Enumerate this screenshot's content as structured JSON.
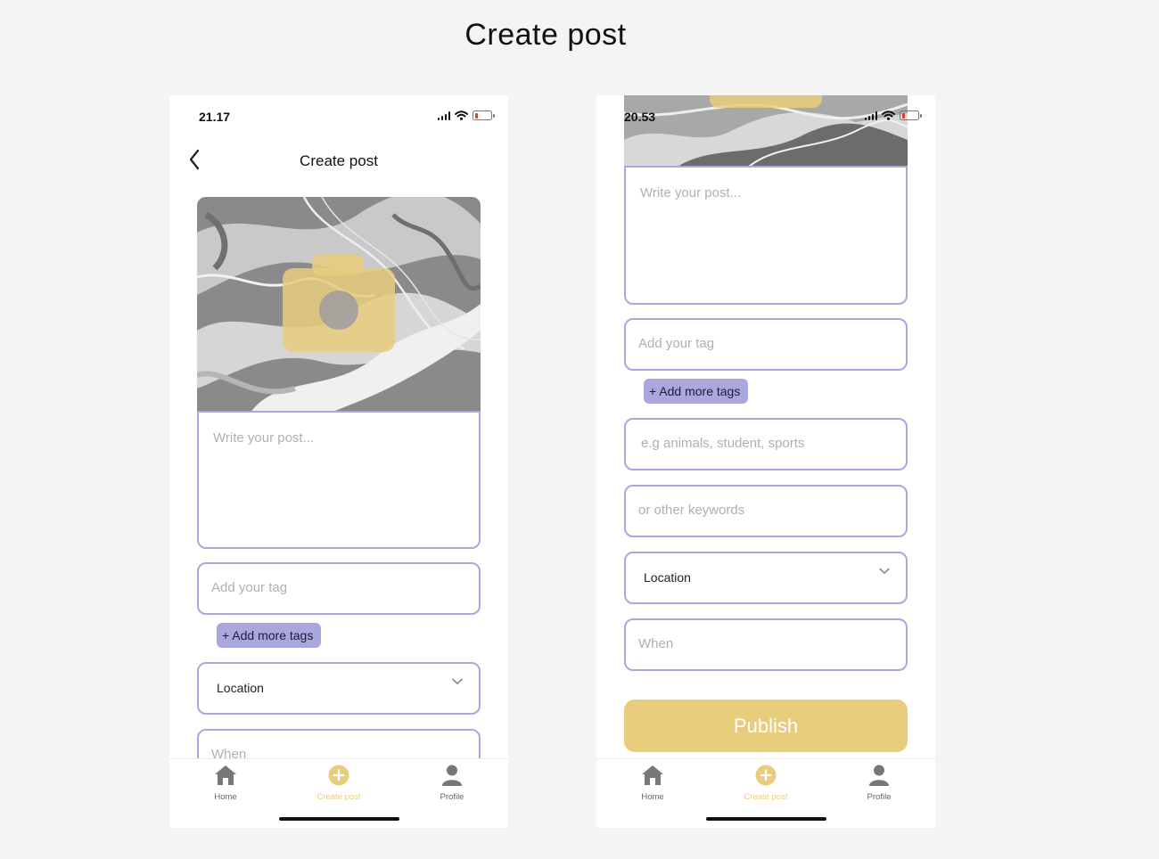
{
  "page": {
    "title": "Create post"
  },
  "screens": [
    {
      "time": "21.17",
      "header": {
        "title": "Create post"
      },
      "post_placeholder": "Write your post...",
      "tag_placeholder": "Add your tag",
      "add_tags_label": "+ Add more tags",
      "location_label": "Location",
      "when_placeholder": "When"
    },
    {
      "time": "20.53",
      "post_placeholder": "Write your post...",
      "tag_placeholder": "Add your tag",
      "add_tags_label": "+ Add more tags",
      "keywords_placeholder_1": "e.g animals, student, sports",
      "keywords_placeholder_2": "or other keywords",
      "location_label": "Location",
      "when_placeholder": "When",
      "publish_label": "Publish"
    }
  ],
  "nav": [
    {
      "label": "Home",
      "icon": "home-icon"
    },
    {
      "label": "Create post",
      "icon": "plus-circle-icon"
    },
    {
      "label": "Profile",
      "icon": "user-icon"
    }
  ],
  "colors": {
    "accent_yellow": "#e8cd7d",
    "border_lavender": "#a9a7dd",
    "placeholder_gray": "#b0b0b0",
    "battery_red": "#e23b2e"
  }
}
